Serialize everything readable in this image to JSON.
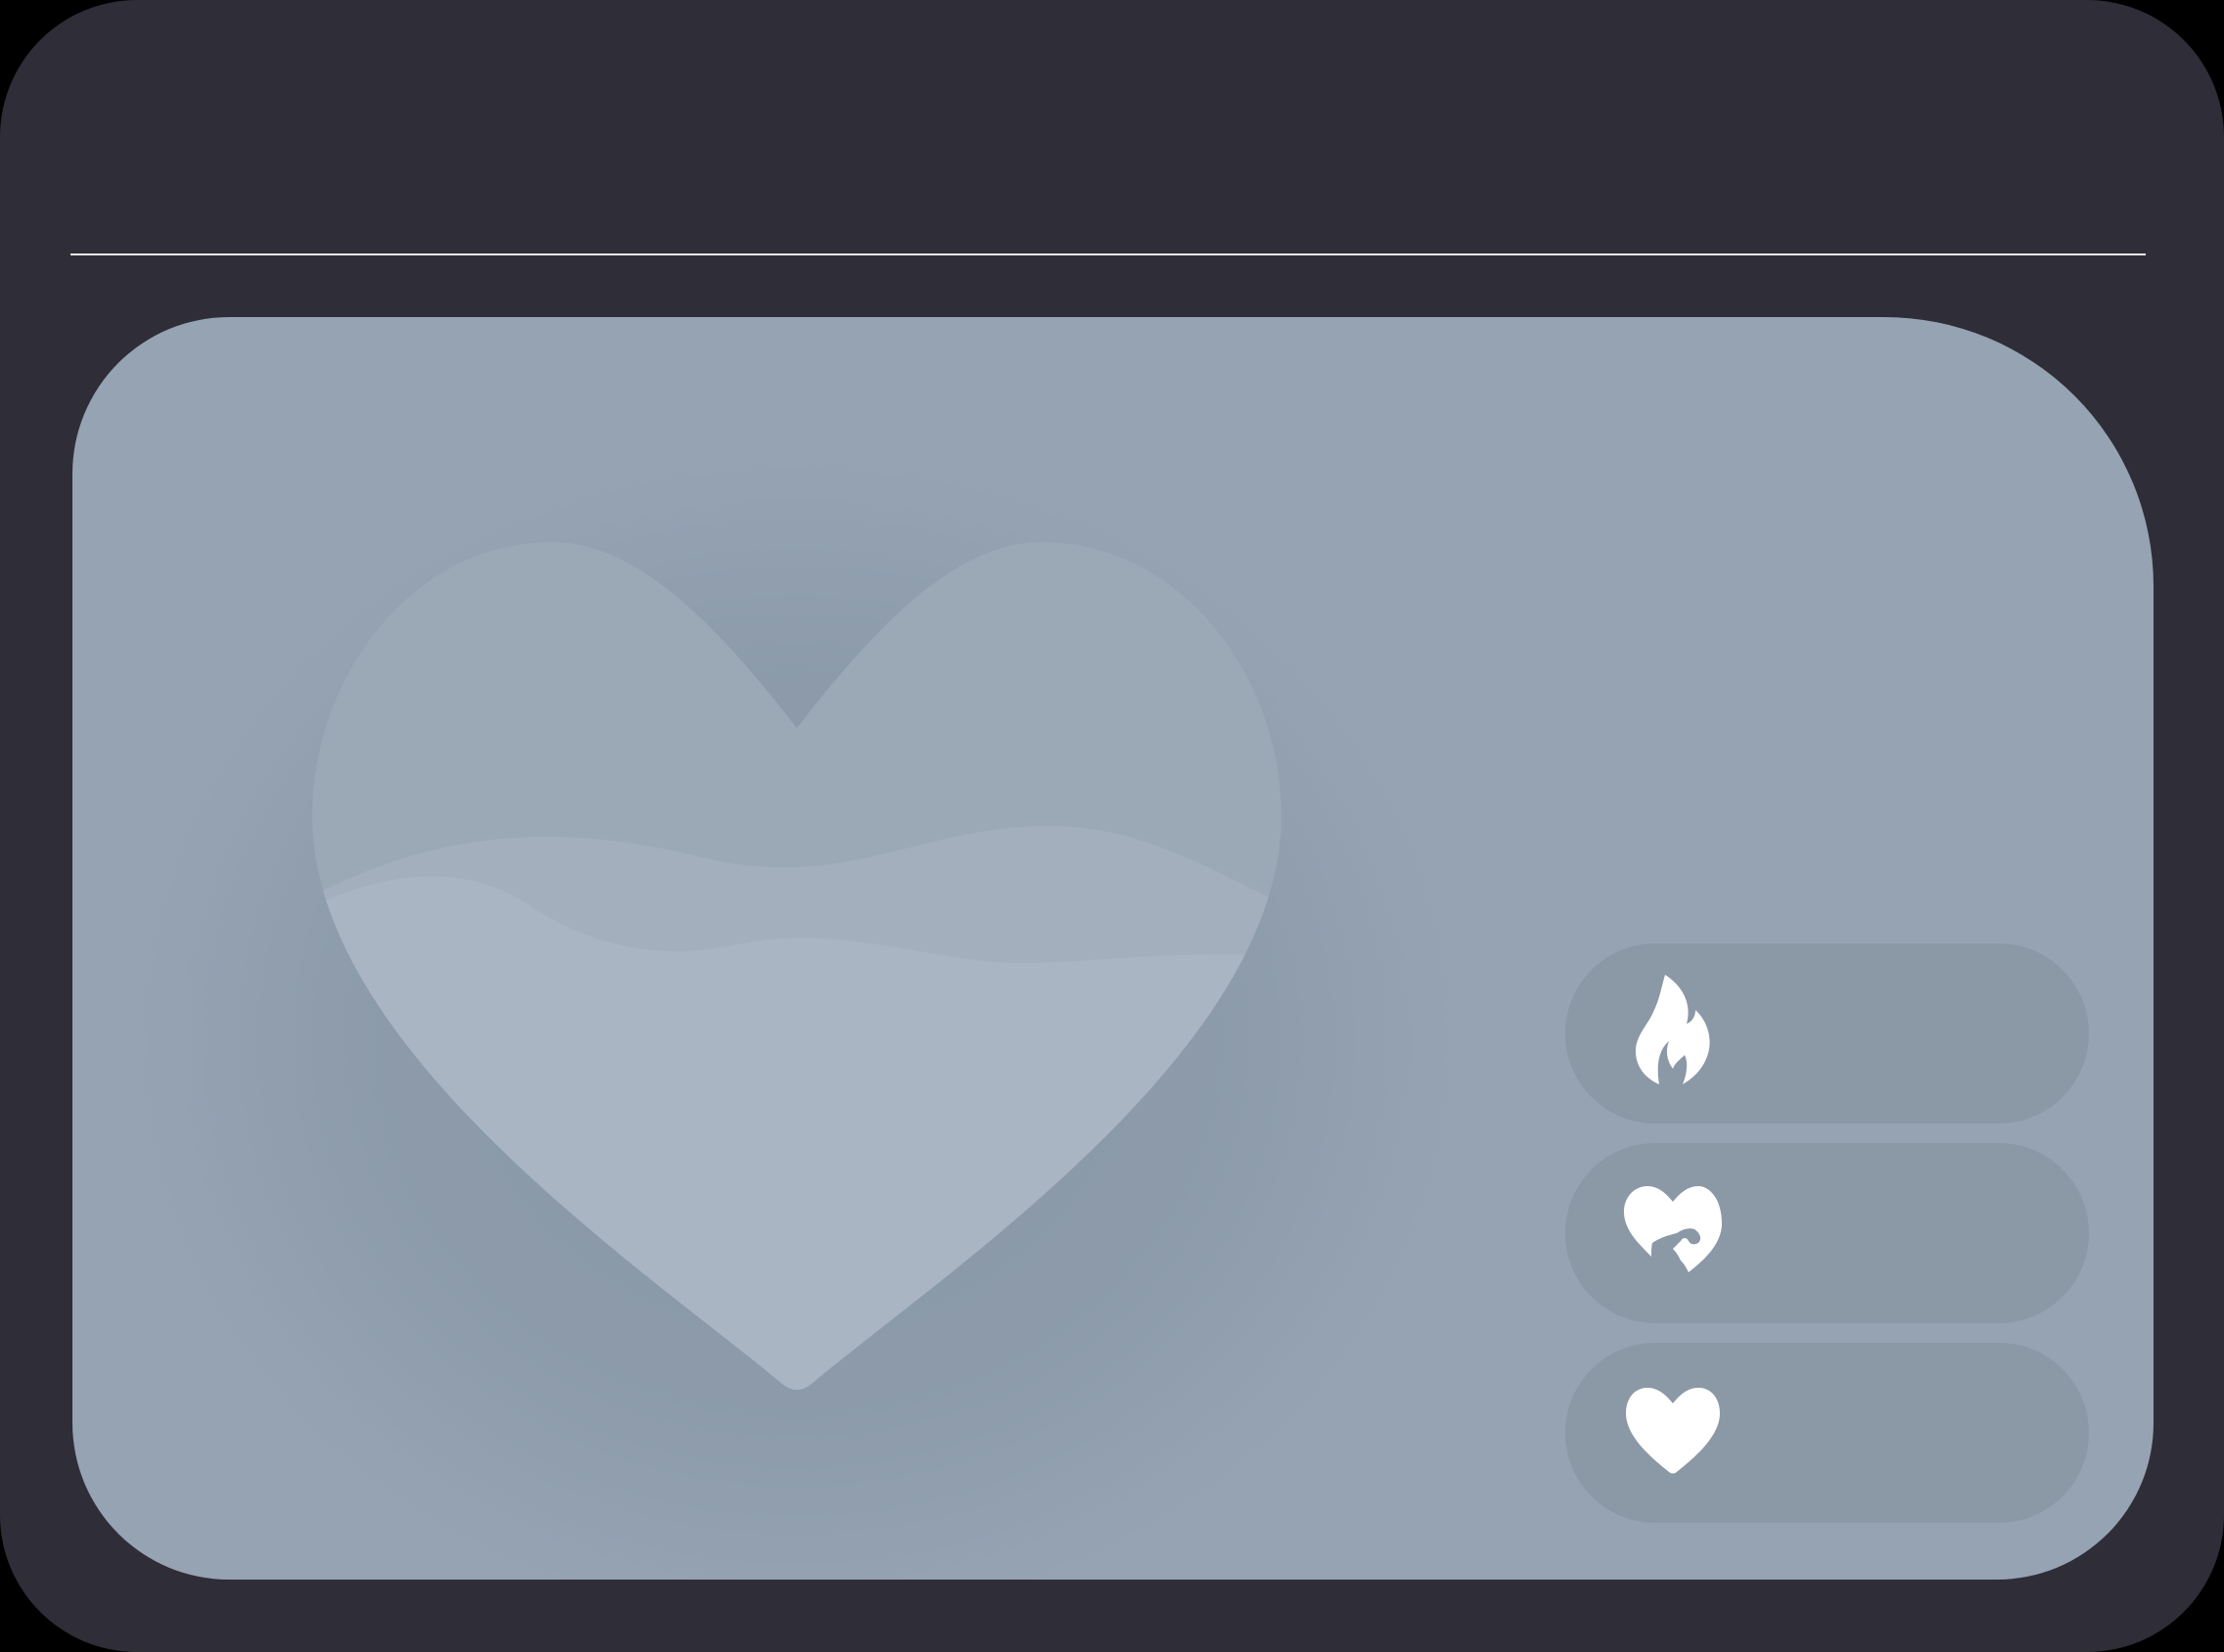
{
  "header": {
    "title": ""
  },
  "colors": {
    "frame": "#2f2d37",
    "divider": "#e9e9ee",
    "panel": "#95a3b3",
    "heart_outline": "#9ba9b7",
    "heart_fill": "#a9b5c2",
    "button_bg": "#8b98a6",
    "icon": "#ffffff"
  },
  "heart": {
    "fill_level": 0.5
  },
  "actions": [
    {
      "id": "flame",
      "icon": "flame-icon",
      "label": ""
    },
    {
      "id": "heart-hand",
      "icon": "heart-hand-icon",
      "label": ""
    },
    {
      "id": "heart",
      "icon": "heart-icon",
      "label": ""
    }
  ]
}
